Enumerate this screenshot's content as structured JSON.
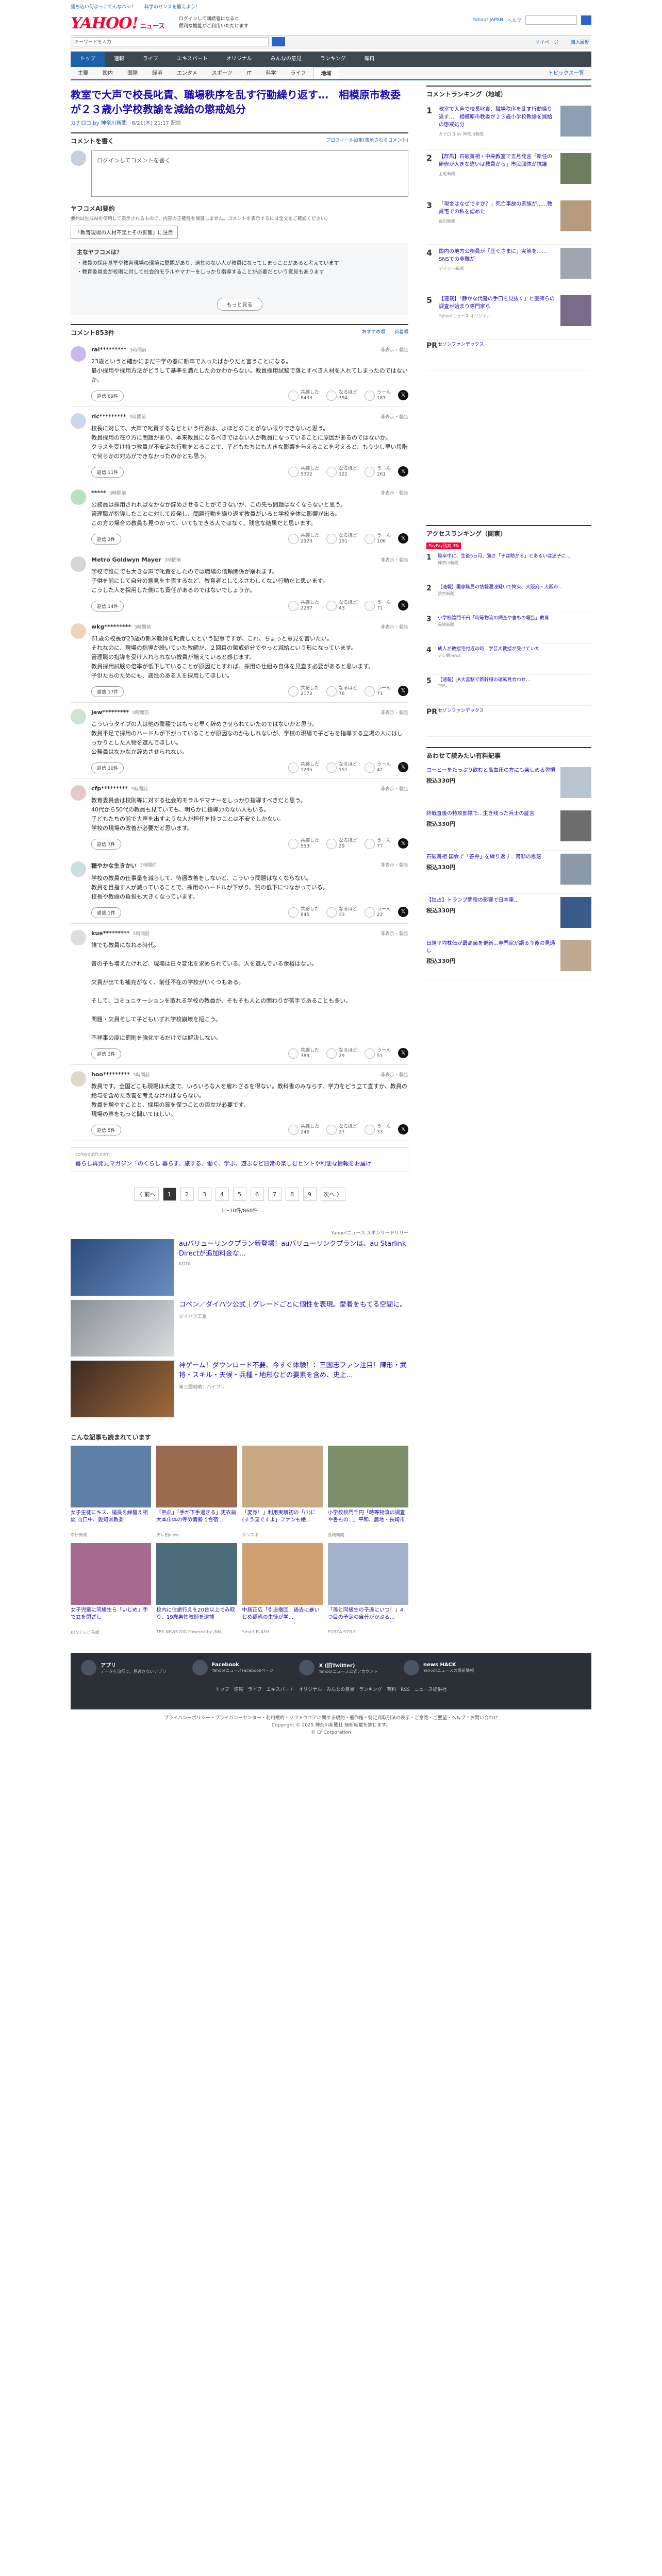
{
  "top_links": [
    "落ち込い何ぶっこてんなバシ？",
    "科学のセンスを鍛えよう！"
  ],
  "brand": {
    "logo": "YAHOO!",
    "sub": "ニュース",
    "promo1": "ログインして購読者になると",
    "promo2": "便利な機能がご利用いただけます"
  },
  "header_right": [
    "Yahoo! JAPAN",
    "ヘルプ"
  ],
  "search": {
    "placeholder": "キーワードを入力",
    "right": [
      "マイページ",
      "購入履歴"
    ]
  },
  "nav_main": [
    "トップ",
    "速報",
    "ライブ",
    "エキスパート",
    "オリジナル",
    "みんなの意見",
    "ランキング",
    "有料"
  ],
  "nav_sub": [
    "主要",
    "国内",
    "国際",
    "経済",
    "エンタメ",
    "スポーツ",
    "IT",
    "科学",
    "ライフ",
    "地域"
  ],
  "nav_sub_active": "地域",
  "topics_label": "トピックス一覧",
  "article": {
    "title": "教室で大声で校長叱責、職場秩序を乱す行動繰り返す…　相模原市教委が２３歳小学校教諭を減給の懲戒処分",
    "source": "カナロコ by 神奈川新聞",
    "date": "8/21(木) 21:17 配信"
  },
  "comment_write": {
    "heading": "コメントを書く",
    "link": "プロフィール設定(表示されるコメント)",
    "placeholder": "ログインしてコメントを書く"
  },
  "ai": {
    "heading": "ヤフコメAI要約",
    "note": "要約は生成AIを使用して表示されるもので、内容の正確性を保証しません。コメントを表示するには全文をご確認ください。",
    "tag": "「教育現場の人材不足とその影響」に注目",
    "box_title": "主なヤフコメは？",
    "points": [
      "教員の採用基準や教育現場の環境に問題があり、適性のない人が教員になってしまうことがあると考えています",
      "教育委員会が校則に対して社会的モラルやマナーをしっかり指導することが必要だという意見もあります"
    ],
    "more": "もっと見る"
  },
  "comments_header": {
    "title": "コメント853件",
    "sort": "おすすめ順",
    "new": "新着順"
  },
  "comments": [
    {
      "name": "rai*********",
      "time": "3時間前",
      "text": "23歳というと確かにまだ中学の春に新卒で入ったばかりだと言うことになる。\n最小採用や採用方法がどうして基準を満たしたのかわからない。教員採用試験で落とすべき人材を入れてしまったのではないか。",
      "reply": "返信 69件",
      "like": "8433",
      "ok": "394",
      "bad": "183"
    },
    {
      "name": "ric*********",
      "time": "3時間前",
      "text": "校長に対して、大声で叱責するなどという行為は、よほどのことがない限りできないと思う。\n教員採用の在り方に問題があり、本来教員になるべきではない人が教員になっていることに原因があるのではないか。\nクラスを受け持つ教員が不安定な行動をとることで、子どもたちにも大きな影響を与えることを考えると、もう少し早い段階で何らかの対応ができなかったのかとも思う。",
      "reply": "返信 11件",
      "like": "5302",
      "ok": "122",
      "bad": "261"
    },
    {
      "name": "*****",
      "time": "3時間前",
      "text": "公務員は採用されればなかなか辞めさせることができないが、この先も問題はなくならないと思う。\n管理職が指導したことに対して反発し、問題行動を繰り返す教員がいると学校全体に影響が出る。\nこの方の場合の教員も見つかって、いてもできる人ではなく、残念な結果だと思います。",
      "reply": "返信 2件",
      "like": "2928",
      "ok": "191",
      "bad": "106"
    },
    {
      "name": "Metro Goldwyn Mayer",
      "time": "3時間前",
      "text": "学校で誰にでも大きな声で叱責をしたのでは職場の信頼関係が崩れます。\n子供を前にして自分の意見を主張するなど、教育者としてふさわしくない行動だと思います。\nこうした人を採用した側にも責任があるのではないでしょうか。",
      "reply": "返信 14件",
      "like": "2287",
      "ok": "43",
      "bad": "71"
    },
    {
      "name": "wkg*********",
      "time": "3時間前",
      "text": "61歳の校長が23歳の新米教師を叱責したという記事ですが、これ、ちょっと意見を言いたい。\nそれなのに、現場の指導が続いていた教師が、２回目の懲戒処分でやっと減給という形になっています。\n管理職の指導を受け入れられない教員が増えていると感じます。\n教員採用試験の倍率が低下していることが原因だとすれば、採用の仕組み自体を見直す必要があると思います。\n子供たちのためにも、適性のある人を採用してほしい。",
      "reply": "返信 17件",
      "like": "2172",
      "ok": "76",
      "bad": "71"
    },
    {
      "name": "jaw*********",
      "time": "3時間前",
      "text": "こういうタイプの人は他の業種ではもっと早く辞めさせられていたのではないかと思う。\n教員不足で採用のハードルが下がっていることが原因なのかもしれないが、学校の現場で子どもを指導する立場の人にはしっかりとした人物を選んでほしい。\n公務員はなかなか辞めさせられない。",
      "reply": "返信 10件",
      "like": "1295",
      "ok": "151",
      "bad": "42"
    },
    {
      "name": "cfp*********",
      "time": "3時間前",
      "text": "教育委員会は校則等に対する社会的モラルやマナーをしっかり指導すべきだと思う。\n40代から50代の教員も見ていても、明らかに指導力のない人もいる。\n子どもたちの前で大声を出すような人が担任を持つことは不安でしかない。\n学校の現場の改善が必要だと思います。",
      "reply": "返信 7件",
      "like": "553",
      "ok": "29",
      "bad": "77"
    },
    {
      "name": "穂やかな生きかい",
      "time": "3時間前",
      "text": "学校の教員の仕事量を減らして、待遇改善をしないと、こういう問題はなくならない。\n教員を目指す人が減っていることで、採用のハードルが下がり、質の低下につながっている。\n校長や教頭の負担も大きくなっています。",
      "reply": "返信 1件",
      "like": "845",
      "ok": "33",
      "bad": "22"
    },
    {
      "name": "kue*********",
      "time": "3時間前",
      "text": "誰でも教員になれる時代。\n\n昔の子も増えたけれど、現場は日々変化を求められている。人を選んでいる余裕はない。\n\n欠員が出ても補充がなく、前任不在の学校がいくつもある。\n\nそして、コミュニケーションを取れる学校の教員が、そもそも人との関わりが苦手であることも多い。\n\n問題・欠員そして子どもいずれ学校崩壊を招こう。\n\n不祥事の度に罰則を強化するだけでは解決しない。",
      "reply": "返信 3件",
      "like": "389",
      "ok": "29",
      "bad": "51"
    },
    {
      "name": "hoo*********",
      "time": "3時間前",
      "text": "教員です。全国どこも現場は大変で、いろいろな人を雇わざるを得ない。教科書のみならず、学力をどう立て直すか、教員の給与を含めた改善を考えなければならない。\n教員を増やすことと、採用の質を保つことの両立が必要です。\n現場の声をもっと聞いてほしい。",
      "reply": "返信 5件",
      "like": "246",
      "ok": "27",
      "bad": "33"
    }
  ],
  "reaction_labels": {
    "like": "共感した",
    "ok": "なるほど",
    "bad": "うーん"
  },
  "ad_row": {
    "src": "coloyoutfr.com",
    "text": "暮らし再発見マガジン「のくらし 暮らす、旅する、働く、学ぶ。遊ぶなど日常の楽しむヒントや利便な情報をお届け"
  },
  "pager": {
    "prev": "〈 前へ",
    "pages": [
      "1",
      "2",
      "3",
      "4",
      "5",
      "6",
      "7",
      "8",
      "9"
    ],
    "next": "次へ 〉",
    "info": "1〜10件/860件"
  },
  "ads_label": "Yahoo!ニュース スポンサードリリー",
  "big_ads": [
    {
      "text": "auバリューリンクプラン新登場！auバリューリンクプランは、au Starlink Directが追加料金な...",
      "sp": "KDDI"
    },
    {
      "text": "コペン／ダイハツ公式｜グレードごとに個性を表現。愛着をもてる空間に。",
      "sp": "ダイハツ工業"
    },
    {
      "text": "神ゲーム！ダウンロード不要、今すぐ体験！：三国志ファン注目！陣形・武将・スキル・天候・兵種・地形などの要素を含め、史上...",
      "sp": "第三國戦略：ハイブリ"
    }
  ],
  "recommend": {
    "heading": "こんな記事も読まれています",
    "items": [
      {
        "text": "女子生徒にキス、議員を繰替え相談 山口中、愛知県教委",
        "src": "中日新聞"
      },
      {
        "text": "「熱血」「手が下手過ぎる」更衣前大本山体の寺め情勢で合宿...",
        "src": "テレ朝news"
      },
      {
        "text": "「変身！」利用実績初の「(?)に(すう国ですよ」ファンも絶...",
        "src": "サンスポ"
      },
      {
        "text": "小学校校門千円「時等物流の調査や書もの...」平和、農地・長崎市",
        "src": "長崎新聞"
      },
      {
        "text": "女子児童に同級生ら「いじめ」手で立を閉ざし",
        "src": "KTNテレビ長崎"
      },
      {
        "text": "校内に住旅行えを20台以上でみ取り、19歳男性教師を逮捕",
        "src": "TBS NEWS DIG Powered by JNN"
      },
      {
        "text": "中居正広「引退撤回」過去に暴いじめ疑惑の生徒が学...",
        "src": "Smart FLASH"
      },
      {
        "text": "「孫と同級生の子達にいつ！」4つ目の予定の自分がかぶる...",
        "src": "FORZA STYLE"
      }
    ]
  },
  "ranking": {
    "heading": "コメントランキング（地域）",
    "items": [
      {
        "text": "教室で大声で校長叱責、職場秩序を乱す行動繰り返す…　相模原市教委が２３歳小学校教諭を減給の懲戒処分",
        "src": "カナロコ by 神奈川新聞"
      },
      {
        "text": "【群馬】石破首相・中央教室で五月発言「新任の研修が大きな違いは教員から」市民団体が抗議",
        "src": "上毛新聞"
      },
      {
        "text": "「現金はなぜですか？」死亡事故の家族が……教員宅での私を認めた",
        "src": "毎日新聞"
      },
      {
        "text": "国内の地方公務員が「圧ぐさまに」実態を……SNSでの非難が",
        "src": "デイリー新潮"
      },
      {
        "text": "【連載】「静かな代替の手口を見抜く」と医師らの調査が始まり専門家ら",
        "src": "Yahoo!ニュース オリジナル"
      }
    ],
    "pr": "セゾンファンデックス"
  },
  "access": {
    "heading": "アクセスランキング（関東）",
    "items": [
      {
        "text": "脳卒中に、生後5ヵ月、驚き「子は助かる」とあるいは迷子に...",
        "src": "神奈川新聞"
      },
      {
        "text": "【速報】国家職員の情報漏洩疑いで拘束、大阪府・大阪市...",
        "src": "読売新聞"
      },
      {
        "text": "小学校陰門千円「時等物流の調査や書もの報告」教育...",
        "src": "長崎新聞"
      },
      {
        "text": "成人が教授宅付近の時...学芸大教授が受けていた",
        "src": "テレ朝news"
      },
      {
        "text": "【速報】JR大宮駅で新幹線の運転見合わせ...",
        "src": "TBS"
      }
    ],
    "pr": "セゾンファンデックス",
    "badge": "PayPay残高 3%"
  },
  "shopping": {
    "heading": "あわせて読みたい有料記事",
    "items": [
      {
        "text": "コーヒーをたっぷり飲むと高血圧の方にも楽しめる習慣",
        "price": "税込330円"
      },
      {
        "text": "終戦直後の特攻部隊で...生き残った兵士の証言",
        "price": "税込330円"
      },
      {
        "text": "石破首相 国会で「答弁」を繰り返す...官邸の思惑",
        "price": "税込330円"
      },
      {
        "text": "【独占】トランプ関税の影響で日本車...",
        "price": "税込330円"
      },
      {
        "text": "日経平均株価が最高値を更新...専門家が語る今後の見通し",
        "price": "税込330円"
      }
    ]
  },
  "footer": {
    "apps": [
      {
        "t": "アプリ",
        "d": "データを流行で、見逃さないアプリ"
      },
      {
        "t": "Facebook",
        "d": "Yahoo!ニュースFacebookページ"
      },
      {
        "t": "X (旧Twitter)",
        "d": "Yahoo!ニュース公式アカウント"
      },
      {
        "t": "news HACK",
        "d": "Yahoo!ニュースの最新情報"
      }
    ],
    "links": "トップ　速報　ライブ　エキスパート　オリジナル　みんなの意見　ランキング　有料　RSS　ニュース提供社",
    "legal": "プライバシーポリシー・プライバシーセンター・利用規約・ソフトウエアに関する規約・著作権・特定商取引法の表示・ご意見・ご要望・ヘルプ・お問い合わせ",
    "copy": "Copyright © 2025 神奈川新聞社 無断転載を禁じます。",
    "copy2": "© LY Corporation"
  }
}
